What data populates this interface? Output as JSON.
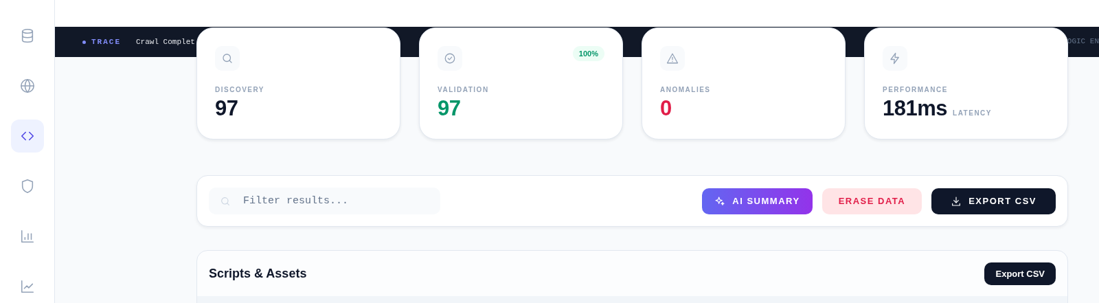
{
  "sidebar": {
    "items": [
      {
        "selected": false
      },
      {
        "selected": false
      },
      {
        "selected": true
      },
      {
        "selected": false
      },
      {
        "selected": false
      },
      {
        "selected": false
      }
    ]
  },
  "ticker": {
    "tag": "TRACE",
    "message": "Crawl Complet",
    "trailing": "OGIC EN"
  },
  "stats": [
    {
      "kind": "discovery",
      "label": "DISCOVERY",
      "value": "97",
      "color": "#0f172a"
    },
    {
      "kind": "validation",
      "label": "VALIDATION",
      "value": "97",
      "color": "#059669",
      "badge": "100%"
    },
    {
      "kind": "anomalies",
      "label": "ANOMALIES",
      "value": "0",
      "color": "#e11d48"
    },
    {
      "kind": "performance",
      "label": "PERFORMANCE",
      "value": "181ms",
      "color": "#0f172a",
      "unit": "LATENCY"
    }
  ],
  "toolbar": {
    "search": {
      "placeholder": "Filter results..."
    },
    "buttons": [
      {
        "kind": "ai",
        "label": "AI SUMMARY"
      },
      {
        "kind": "danger",
        "label": "ERASE DATA"
      },
      {
        "kind": "export",
        "label": "EXPORT CSV"
      }
    ]
  },
  "panel": {
    "title": "Scripts & Assets",
    "button": "Export CSV"
  }
}
